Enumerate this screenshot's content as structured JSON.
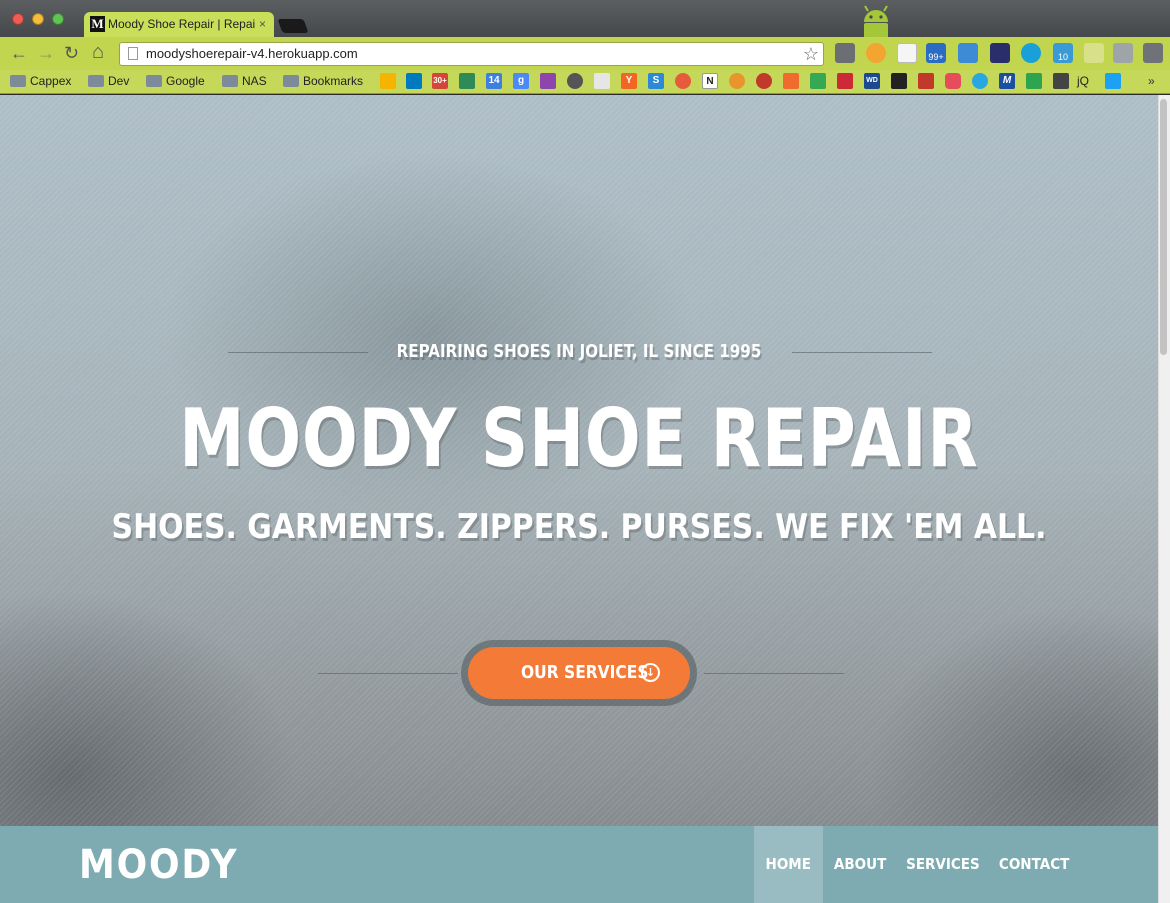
{
  "browser": {
    "tab_title": "Moody Shoe Repair | Repair",
    "tab_close": "×",
    "favicon_letter": "M",
    "url": "moodyshoerepair-v4.herokuapp.com",
    "nav": {
      "back": "←",
      "forward": "→",
      "reload": "↻",
      "home": "⌂"
    },
    "bookmark_folders": [
      "Cappex",
      "Dev",
      "Google",
      "NAS",
      "Bookmarks"
    ],
    "bookmark_icons": [
      {
        "name": "gmail-icon",
        "text": "30+",
        "color": "#d44638"
      },
      {
        "name": "calendar-icon",
        "text": "14",
        "color": "#3f7fe0"
      },
      {
        "name": "google-icon",
        "text": "g",
        "color": "#4a8af4"
      },
      {
        "name": "yc-icon",
        "text": "Y",
        "color": "#f26522"
      },
      {
        "name": "s-icon",
        "text": "S",
        "color": "#2d89d6"
      },
      {
        "name": "notion-icon",
        "text": "N",
        "color": "#222222"
      },
      {
        "name": "wd-icon",
        "text": "WD",
        "color": "#1d4a8e"
      },
      {
        "name": "m-icon",
        "text": "M",
        "color": "#1b4fa0"
      }
    ],
    "bookmark_trailing": "jQ",
    "extension_badges": {
      "badge_99": "99+",
      "badge_10": "10"
    }
  },
  "hero": {
    "tagline": "REPAIRING SHOES IN JOLIET, IL SINCE 1995",
    "title": "MOODY SHOE REPAIR",
    "subtitle": "SHOES. GARMENTS. ZIPPERS. PURSES. WE FIX 'EM ALL.",
    "cta_label": "OUR SERVICES",
    "cta_icon": "↓"
  },
  "navbar": {
    "brand": "MOODY",
    "items": [
      {
        "label": "HOME",
        "active": true
      },
      {
        "label": "ABOUT",
        "active": false
      },
      {
        "label": "SERVICES",
        "active": false
      },
      {
        "label": "CONTACT",
        "active": false
      }
    ]
  },
  "colors": {
    "accent": "#f47b37",
    "navbar": "#7eabb1",
    "nav_active": "#98bcc2",
    "chrome_theme": "#c2d54f"
  }
}
